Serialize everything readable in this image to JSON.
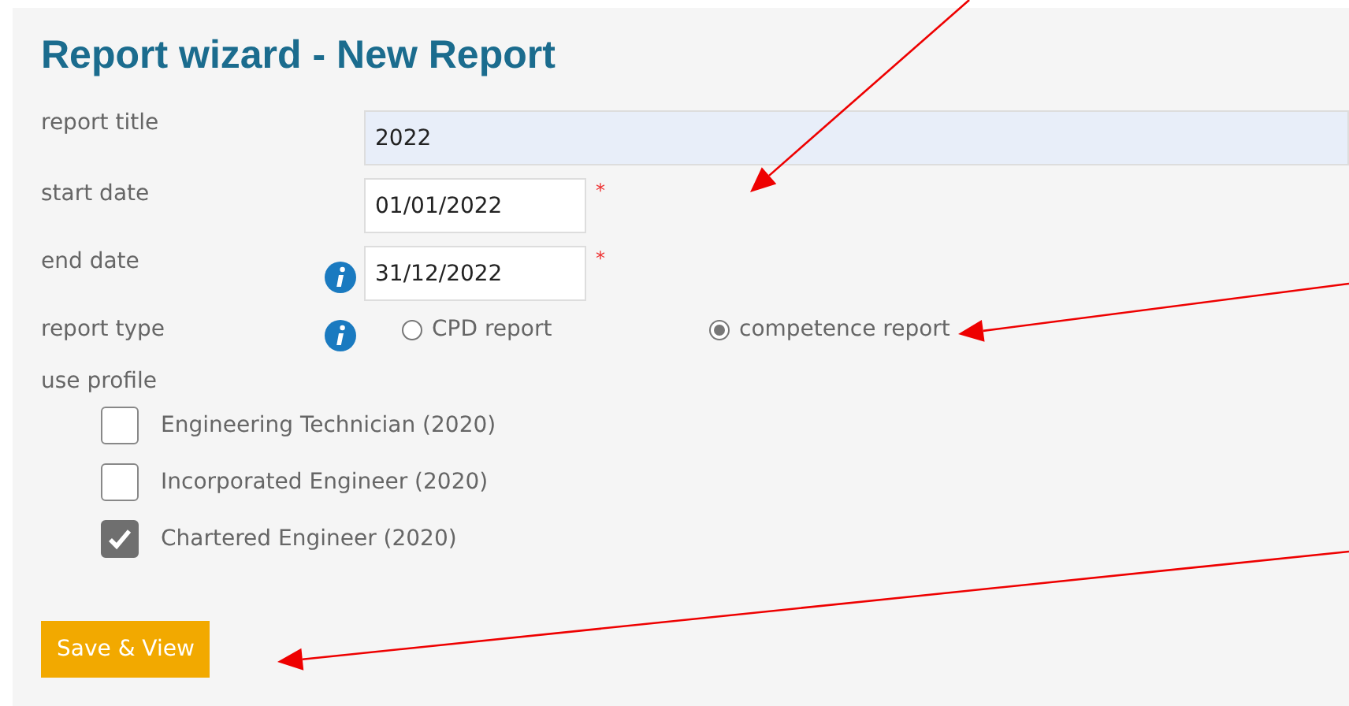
{
  "title": "Report wizard - New Report",
  "fields": [
    {
      "kind": "text",
      "label": "report title",
      "value": "2022",
      "info": false
    },
    {
      "kind": "date",
      "label": "start date",
      "value": "01/01/2022",
      "required_mark": "*",
      "info": false
    },
    {
      "kind": "date",
      "label": "end date",
      "value": "31/12/2022",
      "required_mark": "*",
      "info": true
    }
  ],
  "report_type": {
    "label": "report type",
    "info": true,
    "options": [
      {
        "label": "CPD report",
        "selected": false
      },
      {
        "label": "competence report",
        "selected": true
      }
    ]
  },
  "use_profile": {
    "label": "use profile",
    "options": [
      {
        "label": "Engineering Technician (2020)",
        "checked": false
      },
      {
        "label": "Incorporated Engineer (2020)",
        "checked": false
      },
      {
        "label": "Chartered Engineer (2020)",
        "checked": true
      }
    ]
  },
  "button": "Save & View"
}
